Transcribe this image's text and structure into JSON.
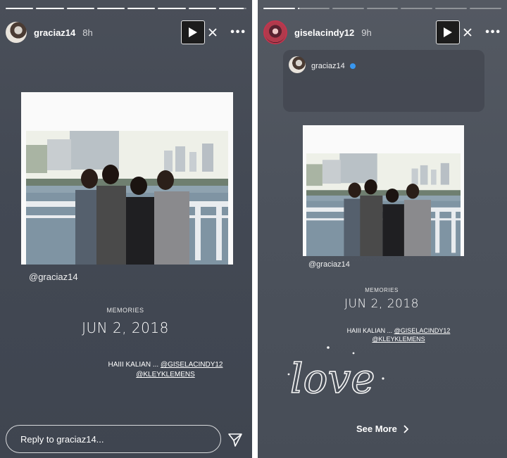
{
  "stories": [
    {
      "id": "left",
      "username": "graciaz14",
      "time": "8h",
      "progress": [
        1,
        1,
        1,
        1,
        1,
        1,
        1,
        0.9
      ],
      "mention": "@graciaz14",
      "memories_label": "MEMORIES",
      "memories_date": "JUN 2, 2018",
      "caption_line1_prefix": "HAIII KALIAN ... ",
      "caption_tag1": "@GISELACINDY12",
      "caption_tag2": "@KLEYKLEMENS",
      "reply_placeholder": "Reply to graciaz14..."
    },
    {
      "id": "right",
      "username": "giselacindy12",
      "time": "9h",
      "progress": [
        1,
        0.05,
        0,
        0,
        0,
        0,
        0
      ],
      "shared_from": "graciaz14",
      "mention": "@graciaz14",
      "memories_label": "MEMORIES",
      "memories_date": "JUN 2, 2018",
      "caption_line1_prefix": "HAIII KALIAN ... ",
      "caption_tag1": "@GISELACINDY12",
      "caption_tag2": "@KLEYKLEMENS",
      "sticker_text": "love",
      "see_more": "See More"
    }
  ],
  "colors": {
    "verified": "#3897f0",
    "play_button_bg": "#1c1c1c"
  }
}
